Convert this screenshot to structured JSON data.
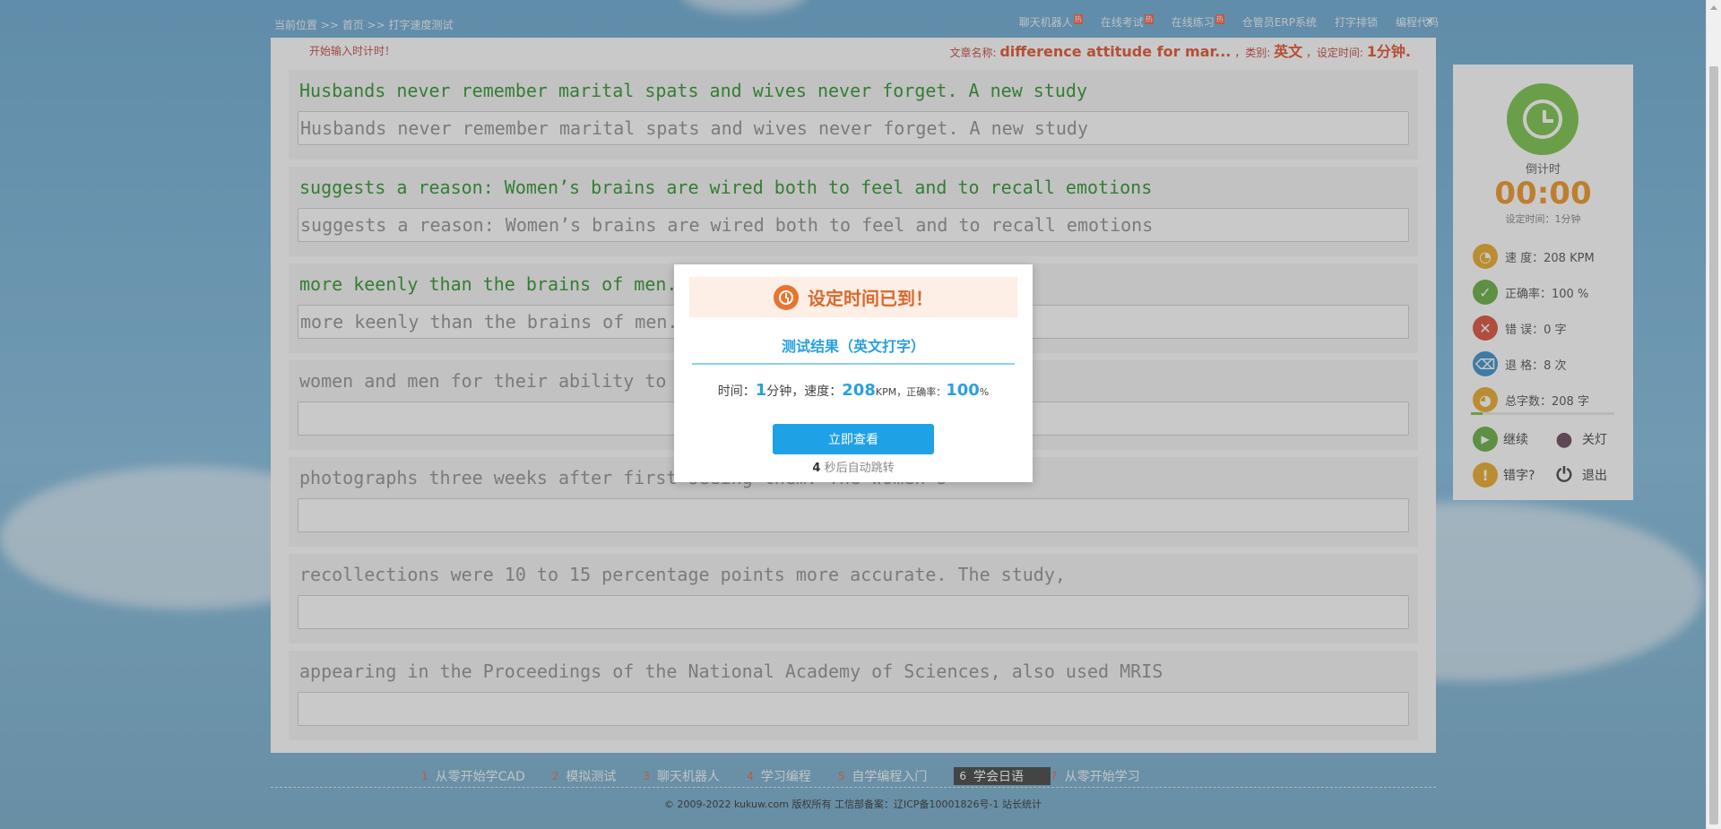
{
  "breadcrumb": {
    "text": "当前位置 >> 首页 >> 打字速度测试"
  },
  "top_nav": {
    "items": [
      {
        "label": "聊天机器人",
        "hot": "热"
      },
      {
        "label": "在线考试",
        "hot": "热"
      },
      {
        "label": "在线练习",
        "hot": "热"
      },
      {
        "label": "仓管员ERP系统",
        "hot": ""
      },
      {
        "label": "打字排锁",
        "hot": ""
      },
      {
        "label": "编程代码",
        "hot": ""
      }
    ]
  },
  "info_bar": {
    "hint": "开始输入时计时！",
    "article_label": "文章名称:",
    "article_name": "difference attitude for mar...",
    "category_label": "，类别:",
    "category": "英文",
    "time_label": "，设定时间:",
    "time_value": "1分钟."
  },
  "lines": [
    {
      "text": "Husbands never remember marital spats and wives never forget. A new study",
      "typed": "Husbands never remember marital spats and wives never forget. A new study",
      "done": true
    },
    {
      "text": "suggests a reason: Women’s brains are wired both to feel and to recall emotions",
      "typed": "suggests a reason: Women’s brains are wired both to feel and to recall emotions",
      "done": true
    },
    {
      "text": "more keenly than the brains of men. Researchers tested two groups of",
      "typed": "more keenly than the brains of men.",
      "done": true
    },
    {
      "text": "women and men for their ability to recall emotionally evocative",
      "typed": "",
      "done": false
    },
    {
      "text": "photographs three weeks after first seeing them. The women’s",
      "typed": "",
      "done": false
    },
    {
      "text": "recollections were 10 to 15 percentage points more accurate. The study,",
      "typed": "",
      "done": false
    },
    {
      "text": "appearing in the Proceedings of the National Academy of Sciences, also used MRIS",
      "typed": "",
      "done": false
    }
  ],
  "side": {
    "countdown_label": "倒计时",
    "countdown_time": "00:00",
    "setting_time": "设定时间：1分钟",
    "stats": [
      {
        "icon": "speedometer-icon",
        "label": "速    度：208 KPM",
        "color": "#e8a317"
      },
      {
        "icon": "check-icon",
        "label": "正确率：100 %",
        "color": "#5aa832"
      },
      {
        "icon": "error-x-icon",
        "label": "错    误：0 字",
        "color": "#d9412c"
      },
      {
        "icon": "backspace-icon",
        "label": "退    格：8 次",
        "color": "#2a86c8"
      },
      {
        "icon": "pie-chart-icon",
        "label": "总字数：208 字",
        "color": "#e8a317"
      }
    ],
    "progress": 0.08,
    "continue_label": "继续",
    "lights_off_label": "关灯",
    "typo_label": "错字?",
    "exit_label": "退出"
  },
  "modal": {
    "title": "设定时间已到！",
    "subtitle": "测试结果（英文打字）",
    "time_label": "时间：",
    "time_value": "1",
    "time_unit": "分钟，速度：",
    "speed_value": "208",
    "speed_unit": "KPM，正确率：",
    "accuracy_value": "100",
    "accuracy_unit": "%",
    "button_label": "立即查看",
    "countdown_num": "4",
    "redirect_text": " 秒后自动跳转"
  },
  "footer": {
    "links": [
      {
        "num": "1",
        "label": "从零开始学CAD"
      },
      {
        "num": "2",
        "label": "模拟测试"
      },
      {
        "num": "3",
        "label": "聊天机器人"
      },
      {
        "num": "4",
        "label": "学习编程"
      },
      {
        "num": "5",
        "label": "自学编程入门"
      },
      {
        "num": "6",
        "label": "学会日语"
      },
      {
        "num": "7",
        "label": "从零开始学习"
      }
    ],
    "active_index": 5,
    "copyright": "© 2009-2022 kukuw.com 版权所有 工信部备案：辽ICP备10001826号-1 站长统计"
  },
  "colors": {
    "accent": "#1fa1e6",
    "correct_text": "#1a8c1a",
    "timer": "#f08c10"
  }
}
